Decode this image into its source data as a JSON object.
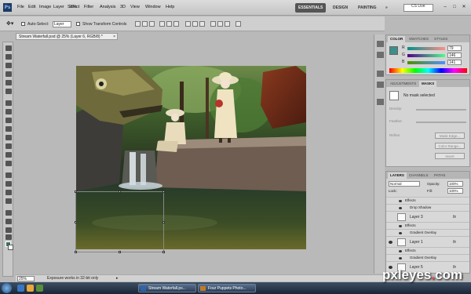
{
  "app": {
    "logo": "Ps",
    "menu": [
      "File",
      "Edit",
      "Image",
      "Layer",
      "Select",
      "Filter",
      "Analysis",
      "3D",
      "View",
      "Window",
      "Help"
    ],
    "zoom": "25%",
    "workspaces": [
      "ESSENTIALS",
      "DESIGN",
      "PAINTING"
    ],
    "active_workspace": "ESSENTIALS",
    "more_workspaces": "»",
    "cs_live": "CS Live",
    "window_buttons": [
      "–",
      "□",
      "✕"
    ]
  },
  "options": {
    "auto_select_label": "Auto-Select:",
    "auto_select_value": "Layer",
    "show_transform_label": "Show Transform Controls"
  },
  "document": {
    "tab_title": "Stream Waterfall.psd @ 25% (Layer 6, RGB/8) *",
    "close": "×"
  },
  "status": {
    "zoom": "25%",
    "message": "Exposure works in 32-bit only",
    "arrow": "▸"
  },
  "color_panel": {
    "tabs": [
      "COLOR",
      "SWATCHES",
      "STYLES"
    ],
    "active_tab": "COLOR",
    "swatch_color": "#3d8f8a",
    "channels": [
      {
        "label": "R",
        "value": "79"
      },
      {
        "label": "G",
        "value": "146"
      },
      {
        "label": "B",
        "value": "141"
      }
    ]
  },
  "masks_panel": {
    "tabs": [
      "ADJUSTMENTS",
      "MASKS"
    ],
    "active_tab": "MASKS",
    "status": "No mask selected",
    "rows": [
      "Density:",
      "Feather:"
    ],
    "refine_label": "Refine:",
    "buttons": [
      "Mask Edge...",
      "Color Range...",
      "Invert"
    ]
  },
  "layers_panel": {
    "tabs": [
      "LAYERS",
      "CHANNELS",
      "PATHS"
    ],
    "active_tab": "LAYERS",
    "blend_mode": "Normal",
    "opacity_label": "Opacity:",
    "opacity": "100%",
    "lock_label": "Lock:",
    "fill_label": "Fill:",
    "fill": "100%",
    "rows": [
      {
        "kind": "sub",
        "name": "Effects"
      },
      {
        "kind": "sub2",
        "name": "Drop Shadow"
      },
      {
        "kind": "layer",
        "name": "Layer 3",
        "fx": "fx"
      },
      {
        "kind": "sub",
        "name": "Effects"
      },
      {
        "kind": "sub2",
        "name": "Gradient Overlay"
      },
      {
        "kind": "layer",
        "name": "Layer 1",
        "fx": "fx"
      },
      {
        "kind": "sub",
        "name": "Effects"
      },
      {
        "kind": "sub2",
        "name": "Gradient Overlay"
      },
      {
        "kind": "layer",
        "name": "Layer 5",
        "fx": "fx"
      }
    ]
  },
  "taskbar": {
    "buttons": [
      "Stream Waterfall.ps...",
      "Four Puppets Photo..."
    ]
  },
  "watermark": {
    "text": "pxleyes",
    "dot": ".",
    "suffix": "com"
  }
}
